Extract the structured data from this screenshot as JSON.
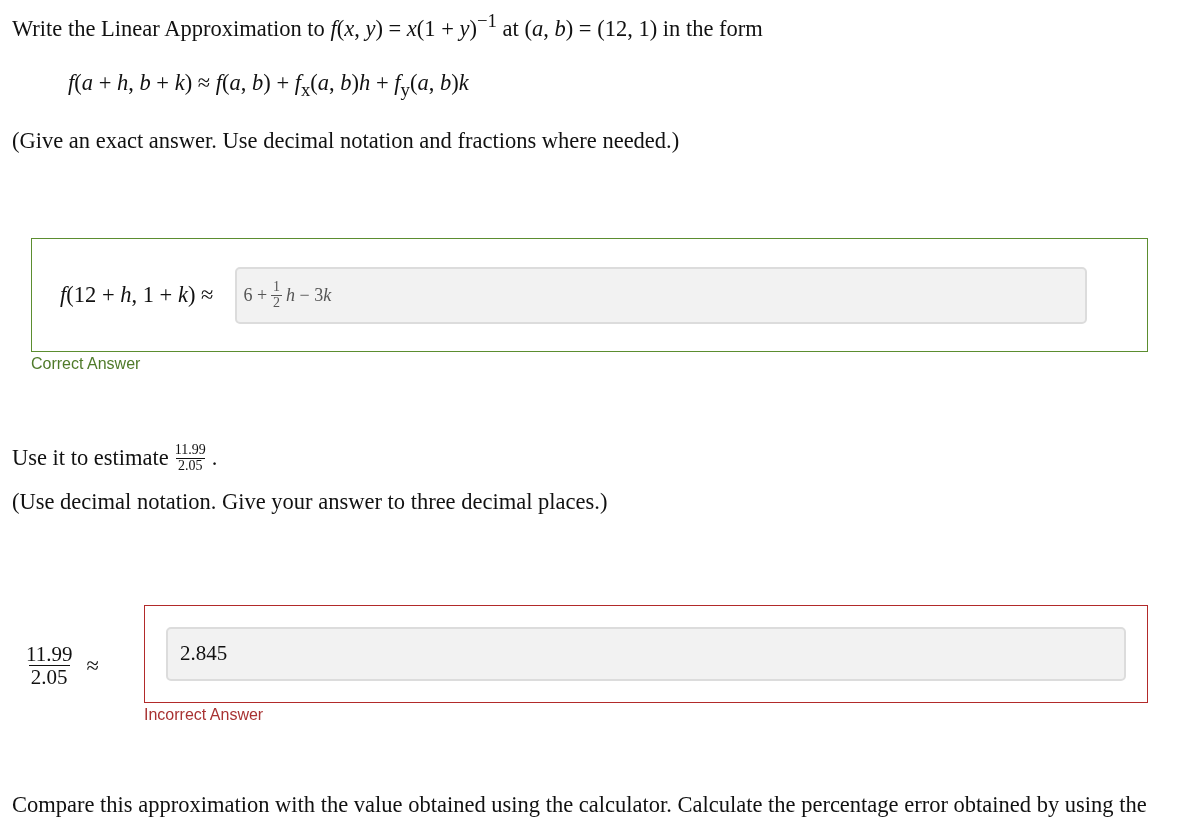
{
  "part_1": {
    "intro": "Write the Linear Approximation to *f*(*x*, *y*) = *x*(1 + *y*)$^{−1}$ at (*a*, *b*) = (12, 1) in the form",
    "formula": "*f*(*a* + *h*, *b* + *k*) ≈ *f*(*a*, *b*) + *f*$_{x}$(*a*, *b*)*h* + *f*$_{y}$(*a*, *b*)*k*",
    "note": "(Give an exact answer. Use decimal notation and fractions where needed.)",
    "answer": {
      "label": "*f*(12 + *h*, 1 + *k*) ≈",
      "value": {
        "prefix": "6 +",
        "fraction": {
          "numerator": "1",
          "denominator": "2"
        },
        "suffix": [
          "*h* − 3",
          "*k*"
        ]
      },
      "correct": true,
      "feedback": "Correct Answer"
    }
  },
  "part_2": {
    "prompt": "Use it to estimate",
    "fraction": {
      "numerator": "11.99",
      "denominator": "2.05"
    },
    "prompt_end": ".",
    "note": "(Use decimal notation. Give your answer to three decimal places.)",
    "answer": {
      "label_fraction": {
        "numerator": "11.99",
        "denominator": "2.05"
      },
      "label_symbol": "≈",
      "value": {
        "prefix": "2.845"
      },
      "correct": false,
      "feedback": "Incorrect Answer"
    }
  },
  "part_3": {
    "prompt": "Compare this approximation with the value obtained using the calculator. Calculate the percentage error obtained by using the"
  }
}
